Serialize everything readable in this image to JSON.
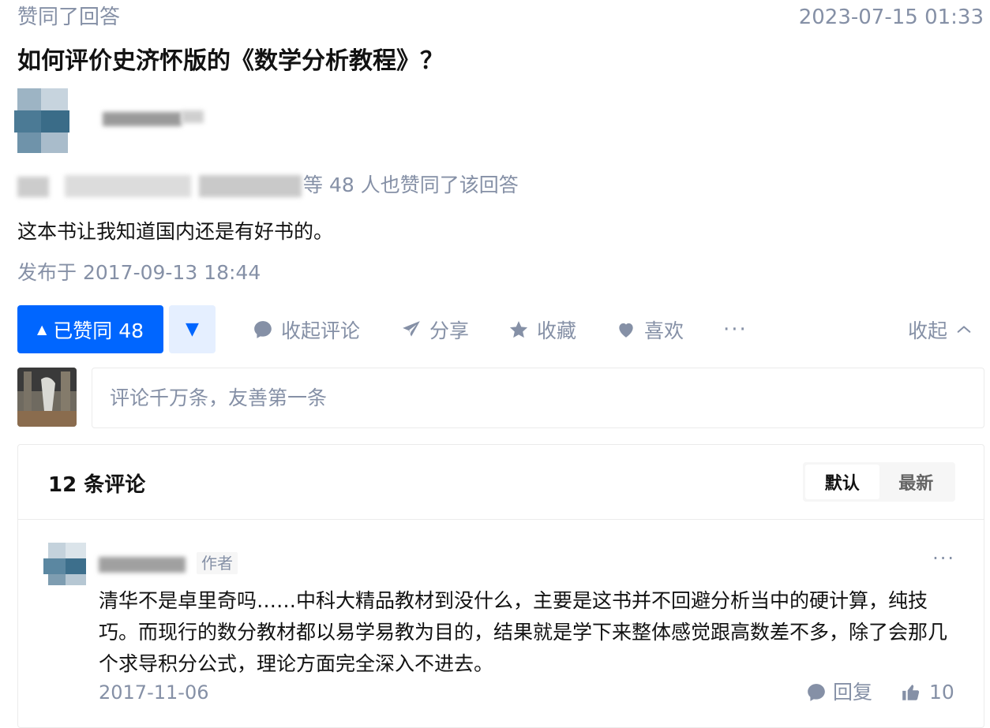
{
  "header": {
    "activity": "赞同了回答",
    "timestamp": "2023-07-15 01:33"
  },
  "question": {
    "title": "如何评价史济怀版的《数学分析教程》？"
  },
  "answer": {
    "voters_text": "等 48 人也赞同了该回答",
    "content": "这本书让我知道国内还是有好书的。",
    "published": "发布于 2017-09-13 18:44"
  },
  "actions": {
    "vote_up_label": "已赞同 48",
    "vote_down_icon": "triangle-down-icon",
    "comment_label": "收起评论",
    "share_label": "分享",
    "collect_label": "收藏",
    "like_label": "喜欢",
    "more_label": "···",
    "collapse_label": "收起"
  },
  "comment_box": {
    "placeholder": "评论千万条，友善第一条"
  },
  "comments": {
    "count_label": "12 条评论",
    "sort": {
      "default": "默认",
      "latest": "最新",
      "selected": "默认"
    },
    "items": [
      {
        "author_tag": "作者",
        "text": "清华不是卓里奇吗……中科大精品教材到没什么，主要是这书并不回避分析当中的硬计算，纯技巧。而现行的数分教材都以易学易教为目的，结果就是学下来整体感觉跟高数差不多，除了会那几个求导积分公式，理论方面完全深入不进去。",
        "date": "2017-11-06",
        "reply_label": "回复",
        "likes": "10",
        "more": "···"
      }
    ]
  },
  "colors": {
    "accent": "#0066ff",
    "accent_light": "#e5efff",
    "muted": "#8590a6",
    "text": "#121212",
    "border": "#ebebeb"
  }
}
